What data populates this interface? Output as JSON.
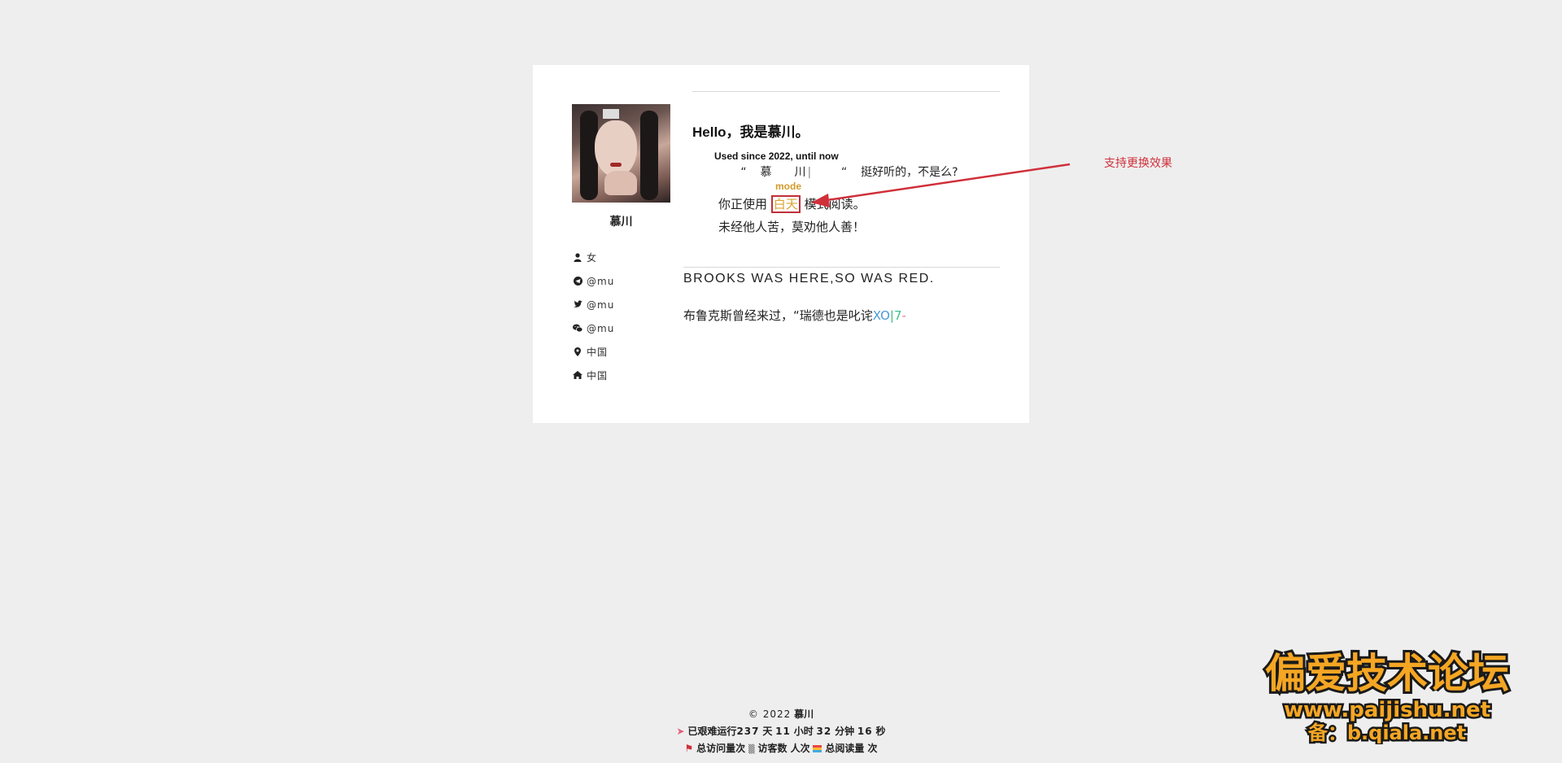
{
  "profile": {
    "name": "慕川",
    "info": [
      {
        "icon": "user-icon",
        "text": "女"
      },
      {
        "icon": "telegram-icon",
        "text": "@mu"
      },
      {
        "icon": "twitter-icon",
        "text": "@mu"
      },
      {
        "icon": "wechat-icon",
        "text": "@mu"
      },
      {
        "icon": "map-marker-icon",
        "text": "中国"
      },
      {
        "icon": "home-icon",
        "text": "中国"
      }
    ]
  },
  "intro": {
    "greeting": "Hello，我是慕川。",
    "since": "Used since 2022, until now",
    "quote_open": "“",
    "quote_name": "慕川",
    "quote_cursor": "|",
    "quote_close": "“",
    "quote_text": "挺好听的，不是么?",
    "mode_label": "mode",
    "mode_prefix": "你正使用",
    "mode_value": "白天",
    "mode_suffix": "模式阅读。",
    "motto": "未经他人苦，莫劝他人善！"
  },
  "brooks": {
    "english": "BROOKS WAS HERE,SO WAS RED.",
    "chinese": "布鲁克斯曾经来过，“瑞德也是叱诧",
    "tail_a": "XO",
    "tail_b": "|7",
    "tail_c": "-"
  },
  "annotation": {
    "text": "支持更换效果",
    "color": "#d0303a"
  },
  "footer": {
    "copyright_prefix": "© 2022",
    "copyright_name": "慕川",
    "uptime_prefix": "已艰难运行",
    "uptime_days": "237",
    "uptime_days_unit": "天",
    "uptime_hours": "11",
    "uptime_hours_unit": "小时",
    "uptime_minutes": "32",
    "uptime_minutes_unit": "分钟",
    "uptime_seconds": "16",
    "uptime_seconds_unit": "秒",
    "total_visits": "总访问量次",
    "visitors": "访客数 人次",
    "total_reads": "总阅读量 次"
  },
  "watermark": {
    "line1": "偏爱技术论坛",
    "line2": "www.paijishu.net",
    "line3": "备：b.qiala.net"
  }
}
